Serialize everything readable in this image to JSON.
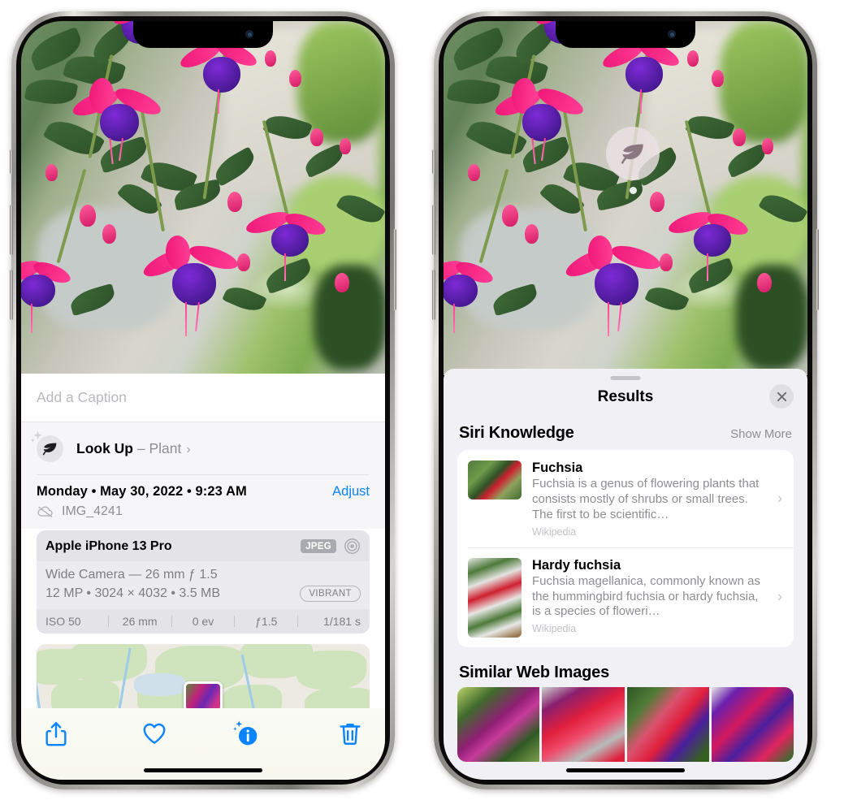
{
  "left_phone": {
    "caption_field": {
      "placeholder": "Add a Caption",
      "value": ""
    },
    "lookup_row": {
      "label": "Look Up",
      "dash": " – ",
      "subject": "Plant",
      "chevron": "›",
      "icon": "leaf-icon"
    },
    "meta": {
      "date": "Monday • May 30, 2022 • 9:23 AM",
      "adjust_label": "Adjust",
      "filename": "IMG_4241",
      "cloud_icon": "cloud-slash-icon"
    },
    "camera_card": {
      "device": "Apple iPhone 13 Pro",
      "format_badge": "JPEG",
      "aperture_icon": "aperture-icon",
      "lens": "Wide Camera — 26 mm ƒ 1.5",
      "size_line": "12 MP • 3024 × 4032 • 3.5 MB",
      "style_badge": "VIBRANT",
      "exif": [
        "ISO 50",
        "26 mm",
        "0 ev",
        "ƒ1.5",
        "1/181 s"
      ]
    },
    "toolbar": {
      "share_label": "share-icon",
      "favorite_label": "heart-icon",
      "info_label": "visual-lookup-info-icon",
      "delete_label": "trash-icon"
    }
  },
  "right_phone": {
    "lookup_badge": {
      "icon": "leaf-icon"
    },
    "sheet": {
      "title": "Results",
      "close_label": "✕"
    },
    "siri_knowledge": {
      "title": "Siri Knowledge",
      "show_more": "Show More",
      "items": [
        {
          "name": "Fuchsia",
          "description": "Fuchsia is a genus of flowering plants that consists mostly of shrubs or small trees. The first to be scientific…",
          "source": "Wikipedia",
          "chevron": "›"
        },
        {
          "name": "Hardy fuchsia",
          "description": "Fuchsia magellanica, commonly known as the hummingbird fuchsia or hardy fuchsia, is a species of floweri…",
          "source": "Wikipedia",
          "chevron": "›"
        }
      ]
    },
    "similar_web_images": {
      "title": "Similar Web Images",
      "count": 4
    }
  },
  "colors": {
    "accent_blue": "#0a84ff",
    "sheet_bg": "#f1f1f5",
    "card_bg": "#ffffff",
    "secondary_text": "#8e8e93"
  }
}
